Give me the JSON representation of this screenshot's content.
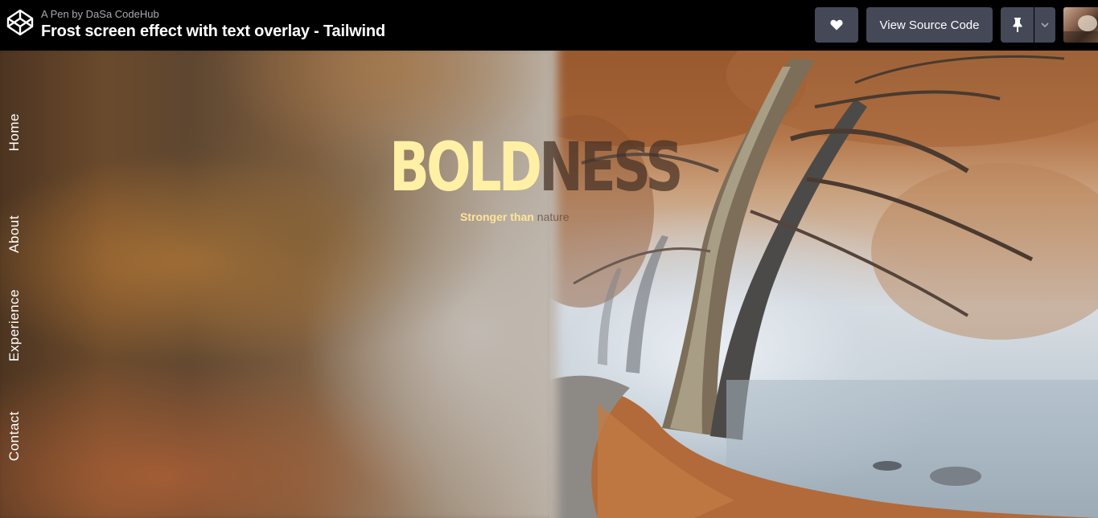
{
  "header": {
    "byline": "A Pen by DaSa CodeHub",
    "title": "Frost screen effect with text overlay - Tailwind",
    "view_source_label": "View Source Code",
    "like_icon": "heart-icon",
    "pin_icon": "pin-icon",
    "caret_icon": "chevron-down-icon"
  },
  "nav": {
    "items": [
      "Home",
      "About",
      "Experience",
      "Contact"
    ]
  },
  "hero": {
    "headline_part1": "BOLD",
    "headline_part2": "NESS",
    "subline_part1": "Stronger than",
    "subline_part2": "nature"
  },
  "colors": {
    "topbar": "#000000",
    "button": "#444857",
    "headline_light": "#fff0a6",
    "subline_light": "#ffe49a"
  }
}
